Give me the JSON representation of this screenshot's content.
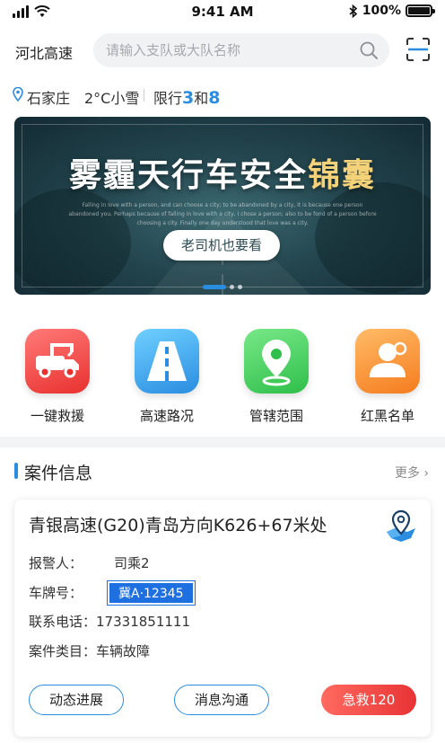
{
  "status_bar": {
    "time": "9:41 AM",
    "battery": "100%"
  },
  "header": {
    "city": "河北高速",
    "search_placeholder": "请输入支队或大队名称"
  },
  "weather": {
    "city": "石家庄",
    "temp": "2°C小雪",
    "limit_label": "限行",
    "limit_num1": "3",
    "limit_and": "和",
    "limit_num2": "8"
  },
  "banner": {
    "title_main": "雾霾天行车安全",
    "title_gold": "锦囊",
    "subtitle": "Falling in love with a person, and can choose a city; to be abandoned by a city, it is because one person abandoned you. Perhaps because of falling in love with a city, I chose a person; also to be fond of a person before choosing a city. Finally one day understood that love was a city.",
    "button": "老司机也要看",
    "slides": 3,
    "active_slide": 1
  },
  "quick_menu": [
    {
      "label": "一键救援",
      "icon": "tow-truck-icon",
      "color_from": "#ff6b6b",
      "color_to": "#e8312f"
    },
    {
      "label": "高速路况",
      "icon": "highway-icon",
      "color_from": "#5cc4ff",
      "color_to": "#2a8de0"
    },
    {
      "label": "管辖范围",
      "icon": "location-pin-icon",
      "color_from": "#6be37a",
      "color_to": "#2fbf4a"
    },
    {
      "label": "红黑名单",
      "icon": "user-list-icon",
      "color_from": "#ffae52",
      "color_to": "#f57c1f"
    }
  ],
  "case_section": {
    "title": "案件信息",
    "more": "更多",
    "card": {
      "location": "青银高速(G20)青岛方向K626+67米处",
      "reporter_label": "报警人：",
      "reporter": "司乘2",
      "plate_label": "车牌号：",
      "plate": "冀A·12345",
      "phone_label": "联系电话：",
      "phone": "17331851111",
      "category_label": "案件类目：",
      "category": "车辆故障",
      "btn_progress": "动态进展",
      "btn_message": "消息沟通",
      "btn_emergency": "急救120"
    }
  }
}
